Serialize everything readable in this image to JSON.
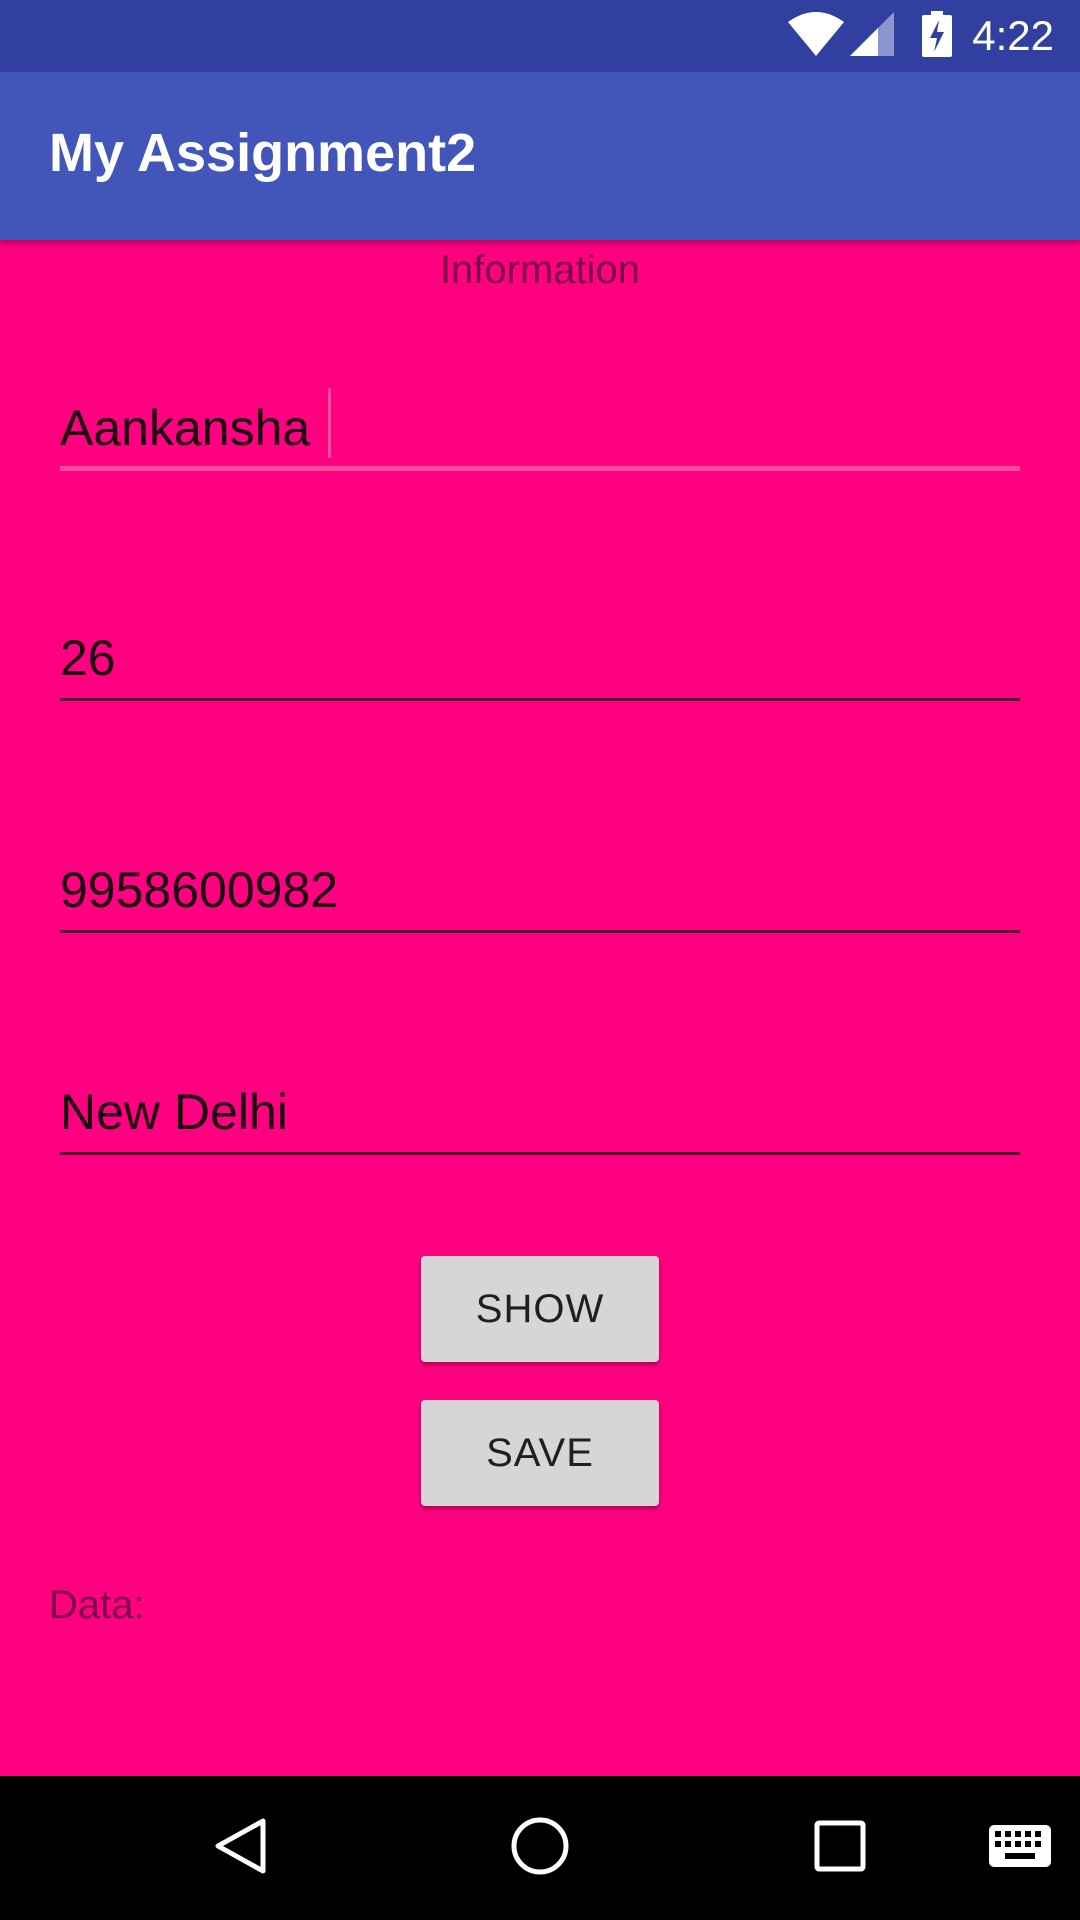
{
  "status_bar": {
    "time": "4:22",
    "icons": [
      "wifi-icon",
      "cell-signal-icon",
      "battery-charging-icon"
    ]
  },
  "app_bar": {
    "title": "My Assignment2"
  },
  "main": {
    "heading": "Information",
    "fields": [
      {
        "value": "Aankansha",
        "focused": true
      },
      {
        "value": "26",
        "focused": false
      },
      {
        "value": "9958600982",
        "focused": false
      },
      {
        "value": "New Delhi",
        "focused": false
      }
    ],
    "show_button": "SHOW",
    "save_button": "SAVE",
    "data_label": "Data:"
  },
  "nav_bar": {
    "icons": [
      "back-icon",
      "home-icon",
      "recents-icon",
      "keyboard-icon"
    ]
  },
  "colors": {
    "background": "#ff0080",
    "status_bar": "#3140a0",
    "app_bar": "#4255b9",
    "accent": "#ff4d9a"
  }
}
